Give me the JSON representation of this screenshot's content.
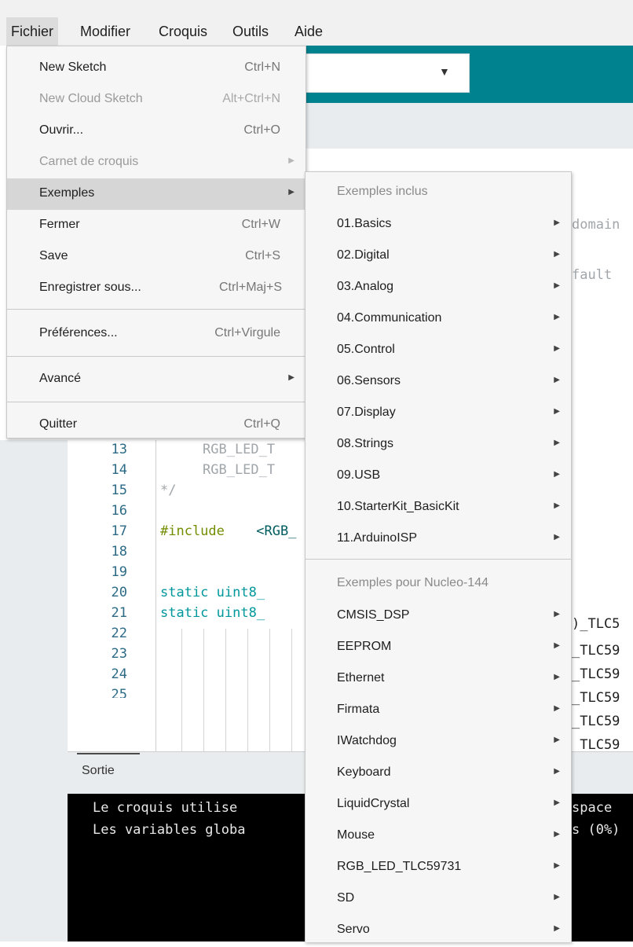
{
  "menubar": {
    "items": [
      "Fichier",
      "Modifier",
      "Croquis",
      "Outils",
      "Aide"
    ]
  },
  "file_menu": {
    "items": [
      {
        "label": "New Sketch",
        "shortcut": "Ctrl+N"
      },
      {
        "label": "New Cloud Sketch",
        "shortcut": "Alt+Ctrl+N"
      },
      {
        "label": "Ouvrir...",
        "shortcut": "Ctrl+O"
      },
      {
        "label": "Carnet de croquis",
        "shortcut": ""
      },
      {
        "label": "Exemples",
        "shortcut": ""
      },
      {
        "label": "Fermer",
        "shortcut": "Ctrl+W"
      },
      {
        "label": "Save",
        "shortcut": "Ctrl+S"
      },
      {
        "label": "Enregistrer sous...",
        "shortcut": "Ctrl+Maj+S"
      },
      {
        "label": "Préférences...",
        "shortcut": "Ctrl+Virgule"
      },
      {
        "label": "Avancé",
        "shortcut": ""
      },
      {
        "label": "Quitter",
        "shortcut": "Ctrl+Q"
      }
    ]
  },
  "examples_menu": {
    "builtin_header": "Exemples inclus",
    "builtin": [
      "01.Basics",
      "02.Digital",
      "03.Analog",
      "04.Communication",
      "05.Control",
      "06.Sensors",
      "07.Display",
      "08.Strings",
      "09.USB",
      "10.StarterKit_BasicKit",
      "11.ArduinoISP"
    ],
    "board_header": "Exemples pour Nucleo-144",
    "board": [
      "CMSIS_DSP",
      "EEPROM",
      "Ethernet",
      "Firmata",
      "IWatchdog",
      "Keyboard",
      "LiquidCrystal",
      "Mouse",
      "RGB_LED_TLC59731",
      "SD",
      "Servo"
    ]
  },
  "editor": {
    "line_numbers": [
      "13",
      "14",
      "15",
      "16",
      "17",
      "18",
      "19",
      "20",
      "21",
      "22",
      "23",
      "24",
      "25"
    ],
    "code": {
      "l13": "RGB_LED_T",
      "l14": "RGB_LED_T",
      "l15": "*/",
      "l17_kw": "#include",
      "l17_rest": " <RGB_",
      "l19": "static uint8_",
      "l20": "static uint8_"
    },
    "peek_right": {
      "domain": "domain",
      "fault": "fault",
      "tlc": [
        ")_TLC5",
        "_TLC59",
        "_TLC59",
        "_TLC59",
        "_TLC59",
        "_TLC59"
      ]
    }
  },
  "output": {
    "label": "Sortie",
    "line1_left": "Le croquis utilise",
    "line1_right": "space",
    "line2_left": "Les variables globa",
    "line2_right": "s (0%)"
  },
  "colors": {
    "toolbar": "#00838f",
    "menu_bg": "#f6f6f6",
    "highlight": "#d6d6d6",
    "console_bg": "#000000"
  }
}
